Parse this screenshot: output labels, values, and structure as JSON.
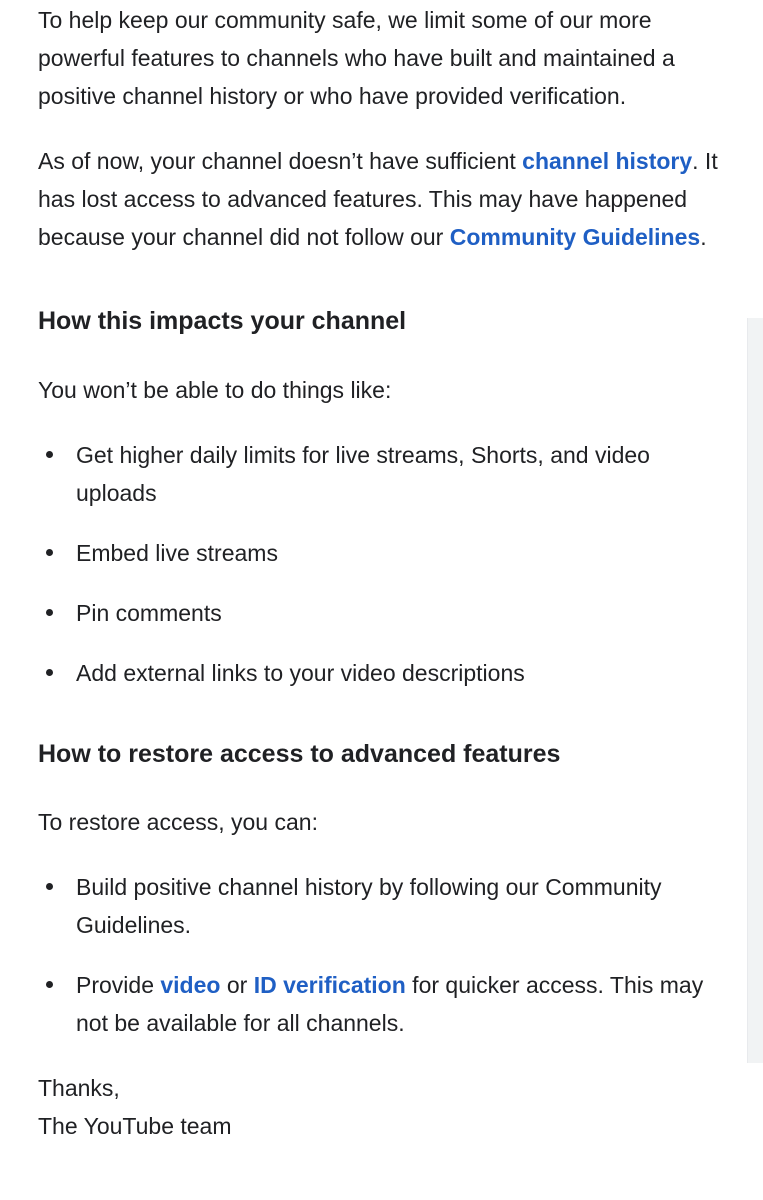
{
  "intro": {
    "paragraph1": "To help keep our community safe, we limit some of our more powerful features to channels who have built and maintained a positive channel history or who have provided verification.",
    "paragraph2_pre": "As of now, your channel doesn’t have sufficient ",
    "paragraph2_link1": "channel history",
    "paragraph2_mid": ". It has lost access to advanced features. This may have happened because your channel did not follow our ",
    "paragraph2_link2": "Community Guidelines",
    "paragraph2_post": "."
  },
  "impacts": {
    "heading": "How this impacts your channel",
    "intro": "You won’t be able to do things like:",
    "items": [
      "Get higher daily limits for live streams, Shorts, and video uploads",
      "Embed live streams",
      "Pin comments",
      "Add external links to your video descriptions"
    ]
  },
  "restore": {
    "heading": "How to restore access to advanced features",
    "intro": "To restore access, you can:",
    "item1": "Build positive channel history by following our Community Guidelines.",
    "item2_pre": "Provide ",
    "item2_link1": "video",
    "item2_mid": " or ",
    "item2_link2": "ID verification",
    "item2_post": " for quicker access. This may not be available for all channels."
  },
  "signoff": {
    "thanks": "Thanks,",
    "team": "The YouTube team"
  },
  "colors": {
    "text": "#202124",
    "link": "#1f5fc4",
    "background": "#ffffff"
  }
}
